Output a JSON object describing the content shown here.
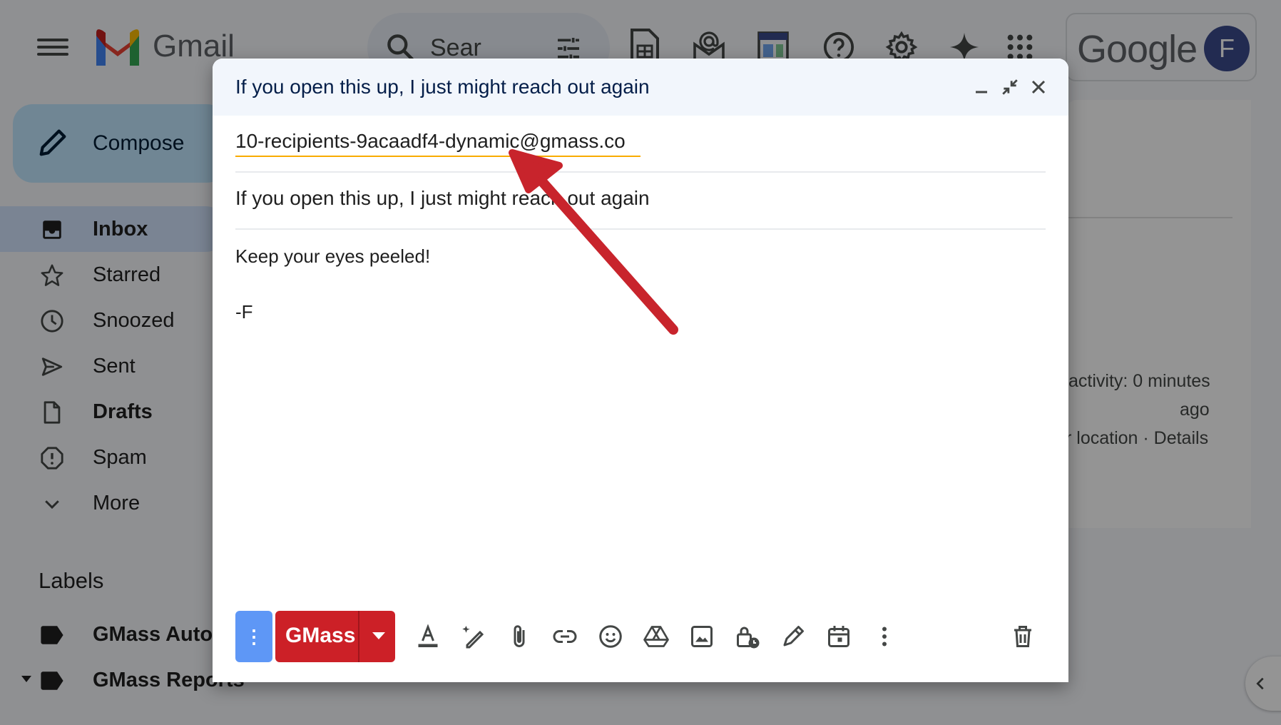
{
  "app": {
    "brand": "Gmail",
    "search_placeholder": "Sear",
    "google_word": "Google",
    "avatar_letter": "F"
  },
  "sidebar": {
    "compose_label": "Compose",
    "items": [
      {
        "label": "Inbox",
        "icon": "inbox-icon"
      },
      {
        "label": "Starred",
        "icon": "star-icon"
      },
      {
        "label": "Snoozed",
        "icon": "clock-icon"
      },
      {
        "label": "Sent",
        "icon": "send-icon"
      },
      {
        "label": "Drafts",
        "icon": "draft-icon"
      },
      {
        "label": "Spam",
        "icon": "spam-icon"
      },
      {
        "label": "More",
        "icon": "chevron-down-icon"
      }
    ],
    "labels_heading": "Labels",
    "labels": [
      {
        "label": "GMass Auto"
      },
      {
        "label": "GMass Reports"
      }
    ]
  },
  "background_panel": {
    "activity_line1": "activity: 0 minutes",
    "activity_line2": "ago",
    "activity_line3": "r location · Details"
  },
  "compose_window": {
    "title": "If you open this up, I just might reach out again",
    "to": "10-recipients-9acaadf4-dynamic@gmass.co",
    "subject": "If you open this up, I just might reach out again",
    "body_line1": "Keep your eyes peeled!",
    "body_line2": "-F",
    "toolbar": {
      "options_label": "⋮",
      "gmass_label": "GMass"
    }
  },
  "colors": {
    "gmass_red": "#cc2027",
    "options_blue": "#5e97f6",
    "annotation_arrow": "#c8242c",
    "compose_header": "#f2f6fc"
  }
}
